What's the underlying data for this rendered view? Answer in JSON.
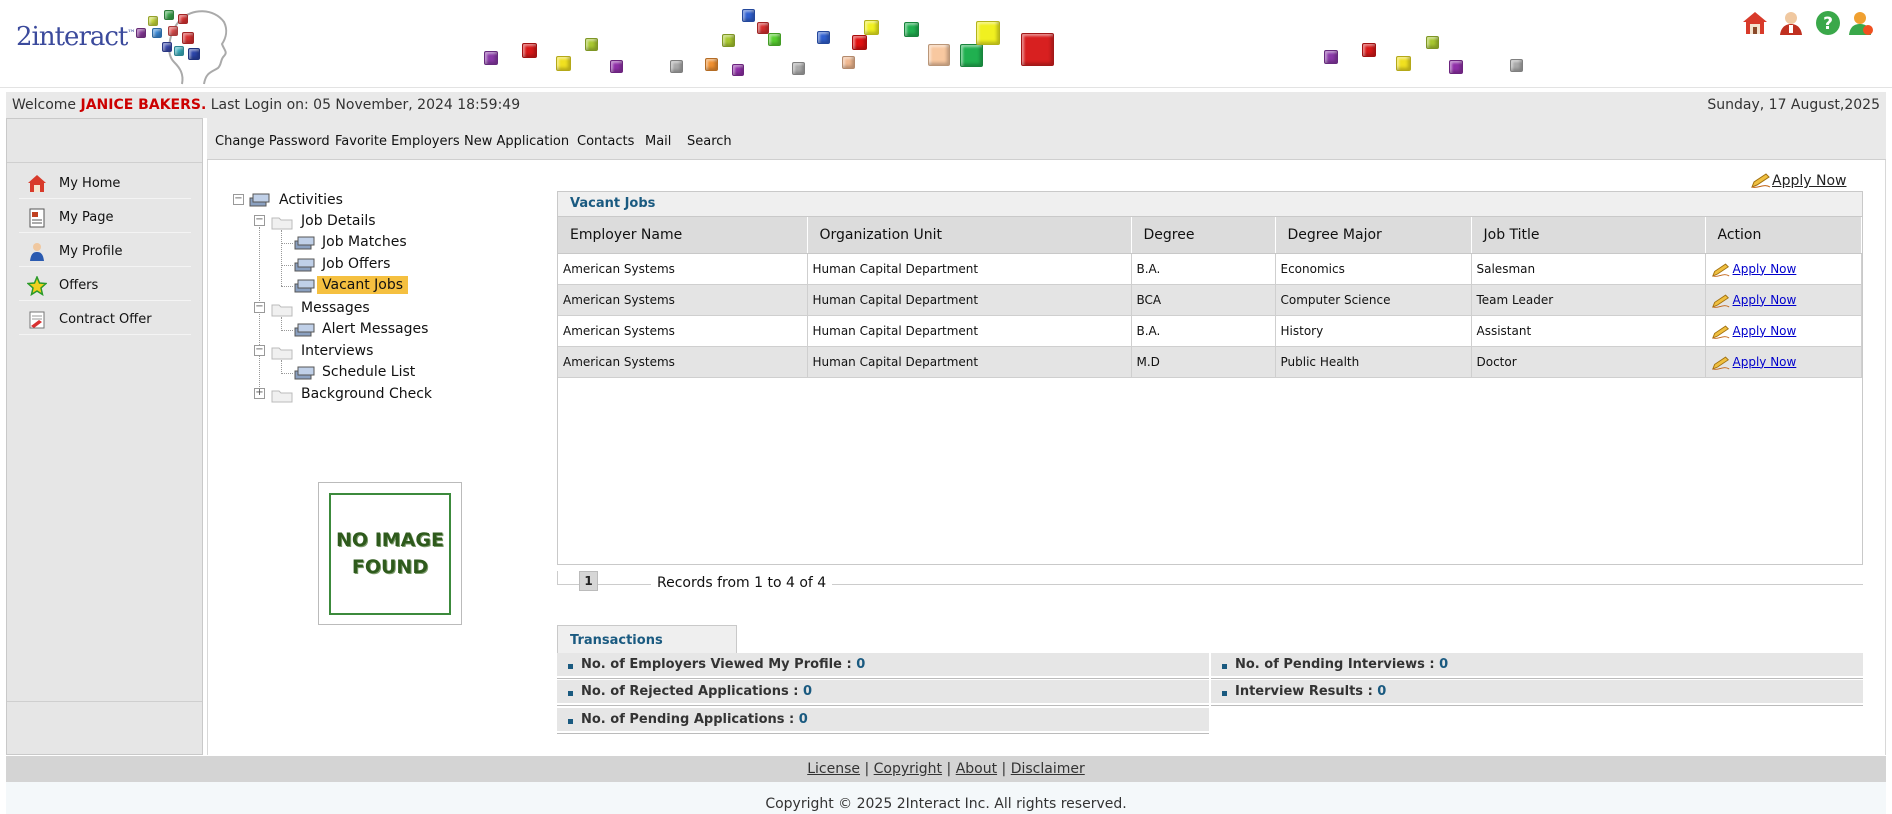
{
  "brand": {
    "logo_text": "2interact",
    "logo_mark": "™"
  },
  "header": {
    "icons": [
      "home-icon",
      "user-admin-icon",
      "help-icon",
      "logout-user-icon"
    ]
  },
  "welcome": {
    "prefix": "Welcome",
    "user_name": "JANICE BAKERS.",
    "last_login": "Last Login on: 05 November, 2024 18:59:49",
    "date": "Sunday, 17 August,2025"
  },
  "sidebar": {
    "items": [
      {
        "label": "My Home",
        "icon": "home-icon"
      },
      {
        "label": "My Page",
        "icon": "page-icon"
      },
      {
        "label": "My Profile",
        "icon": "profile-icon"
      },
      {
        "label": "Offers",
        "icon": "star-icon"
      },
      {
        "label": "Contract Offer",
        "icon": "contract-icon"
      }
    ]
  },
  "menu": {
    "items": [
      "Change Password",
      "Favorite Employers",
      "New Application",
      "Contacts",
      "Mail",
      "Search"
    ]
  },
  "tree": {
    "root": "Activities",
    "job_details": "Job Details",
    "job_matches": "Job Matches",
    "job_offers": "Job Offers",
    "vacant_jobs": "Vacant Jobs",
    "messages": "Messages",
    "alert_messages": "Alert Messages",
    "interviews": "Interviews",
    "schedule_list": "Schedule List",
    "background_check": "Background Check"
  },
  "no_image": {
    "line1": "NO IMAGE",
    "line2": "FOUND"
  },
  "apply_now_top": "Apply Now",
  "jobs": {
    "title": "Vacant Jobs",
    "columns": [
      "Employer Name",
      "Organization Unit",
      "Degree",
      "Degree Major",
      "Job Title",
      "Action"
    ],
    "rows": [
      {
        "employer": "American Systems",
        "org_unit": "Human Capital Department",
        "degree": "B.A.",
        "major": "Economics",
        "job_title": "Salesman",
        "action": "Apply Now"
      },
      {
        "employer": "American Systems",
        "org_unit": "Human Capital Department",
        "degree": "BCA",
        "major": "Computer Science",
        "job_title": "Team Leader",
        "action": "Apply Now"
      },
      {
        "employer": "American Systems",
        "org_unit": "Human Capital Department",
        "degree": "B.A.",
        "major": "History",
        "job_title": "Assistant",
        "action": "Apply Now"
      },
      {
        "employer": "American Systems",
        "org_unit": "Human Capital Department",
        "degree": "M.D",
        "major": "Public Health",
        "job_title": "Doctor",
        "action": "Apply Now"
      }
    ]
  },
  "pager": {
    "page": "1",
    "records": "Records from 1 to 4 of 4"
  },
  "transactions": {
    "title": "Transactions",
    "left": [
      {
        "label": "No. of Employers Viewed My Profile : ",
        "value": "0"
      },
      {
        "label": "No. of Rejected Applications : ",
        "value": "0"
      },
      {
        "label": "No. of Pending Applications : ",
        "value": "0"
      }
    ],
    "right": [
      {
        "label": "No. of Pending Interviews : ",
        "value": "0"
      },
      {
        "label": "Interview Results : ",
        "value": "0"
      }
    ]
  },
  "footer": {
    "links": [
      "License",
      "Copyright",
      "About",
      "Disclaimer"
    ],
    "separator": "|",
    "copyright": "Copyright © 2025 2Interact Inc. All rights reserved."
  },
  "colors": {
    "accent": "#1a5a80",
    "user_name": "#cc0000",
    "selected": "#f5c040",
    "link": "#0000cc"
  }
}
